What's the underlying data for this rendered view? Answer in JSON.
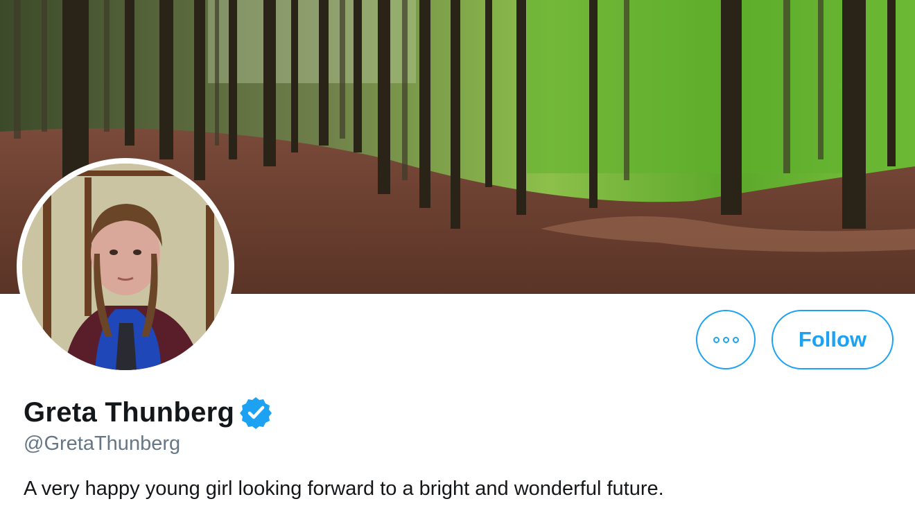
{
  "profile": {
    "display_name": "Greta Thunberg",
    "handle": "@GretaThunberg",
    "bio": "A very happy young girl looking forward to a bright and wonderful future.",
    "verified": true
  },
  "actions": {
    "more_icon": "more-options-icon",
    "follow_label": "Follow"
  },
  "colors": {
    "accent": "#1da1f2",
    "name_text": "#14171a",
    "handle_text": "#657786",
    "background": "#ffffff"
  }
}
